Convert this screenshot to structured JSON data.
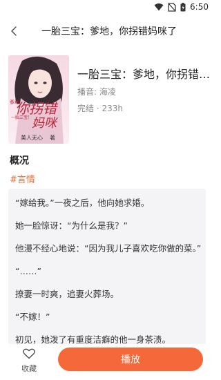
{
  "status_bar": {
    "time": "6:50"
  },
  "header": {
    "title": "一胎三宝：爹地，你拐错妈咪了"
  },
  "book": {
    "title": "一胎三宝：爹地，你拐错妈咪了",
    "narrator": "播音: 海凌",
    "status": "完结 · 233h",
    "cover": {
      "big_title_1": "你拐错",
      "big_title_2": "妈咪",
      "small_title": "一胎三宝!",
      "author": "美人无心",
      "author_suffix": "著",
      "side_text": "爹地"
    }
  },
  "overview": {
    "title": "概况",
    "tag": "#言情",
    "lines": [
      "“嫁给我。”一夜之后，他向她求婚。",
      "她一脸惊讶：“为什么是我？”",
      "他漫不经心地说：“因为我儿子喜欢吃你做的菜。”",
      "“……”",
      "撩妻一时爽，追妻火葬场。",
      "“不嫁！”",
      "初见，她泼了有重度洁癖的他一身茶渍。"
    ]
  },
  "bottom": {
    "favorite_label": "收藏",
    "play_label": "播放"
  },
  "colors": {
    "accent": "#f5683a",
    "tag": "#f06a35"
  }
}
